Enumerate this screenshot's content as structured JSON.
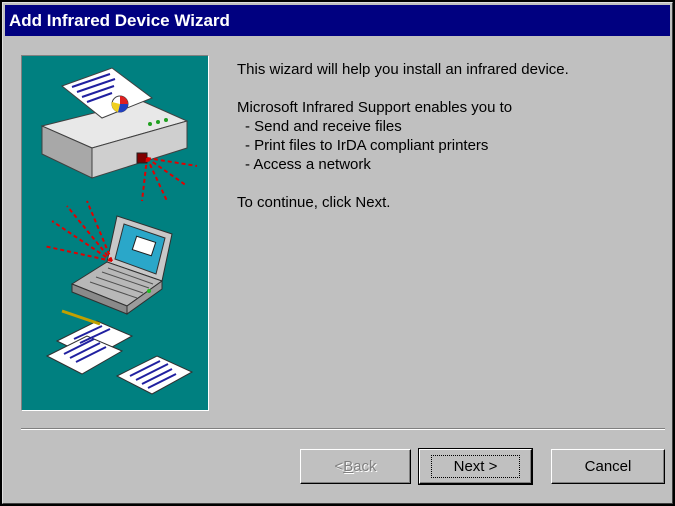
{
  "window": {
    "title": "Add Infrared Device Wizard"
  },
  "content": {
    "intro": "This wizard will help you install an infrared device.",
    "support_heading": "Microsoft Infrared Support enables you to",
    "features": [
      "- Send and receive files",
      "- Print files to IrDA compliant printers",
      "- Access a network"
    ],
    "instruction": "To continue, click Next."
  },
  "buttons": {
    "back": {
      "hotkey": "B",
      "rest": "ack",
      "prefix": "< ",
      "enabled": false
    },
    "next": {
      "label": "Next >",
      "enabled": true
    },
    "cancel": {
      "label": "Cancel",
      "enabled": true
    }
  },
  "colors": {
    "title_bar": "#000080",
    "dialog_face": "#c0c0c0",
    "illustration_background": "#008080"
  },
  "icons": [
    "printer-icon",
    "laptop-icon",
    "infrared-beam-icon",
    "document-icon"
  ]
}
